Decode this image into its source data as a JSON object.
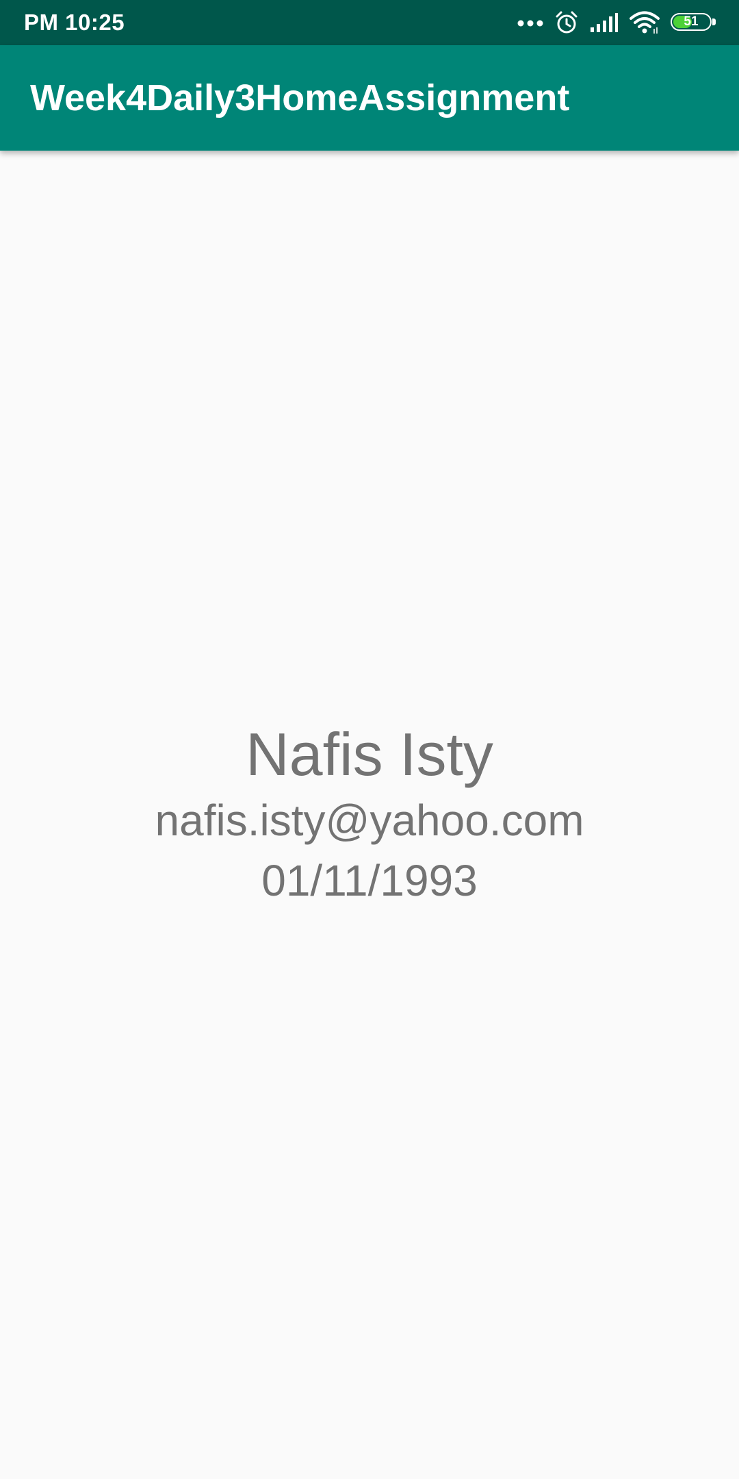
{
  "status_bar": {
    "time": "PM 10:25",
    "battery_level": "51",
    "battery_fraction": 0.51,
    "icons": [
      "more-dots-icon",
      "alarm-icon",
      "signal-icon",
      "wifi-icon",
      "battery-icon"
    ],
    "battery_color": "#4cd137"
  },
  "app_bar": {
    "title": "Week4Daily3HomeAssignment",
    "color": "#008577"
  },
  "profile": {
    "name": "Nafis Isty",
    "email": "nafis.isty@yahoo.com",
    "dob": "01/11/1993",
    "text_color": "#737373"
  },
  "colors": {
    "status_bar": "#00574b",
    "background": "#fafafa"
  }
}
